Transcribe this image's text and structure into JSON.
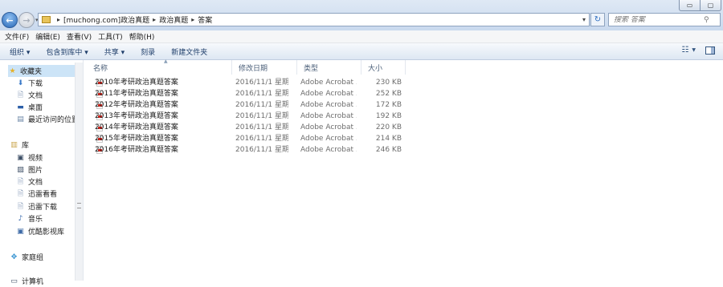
{
  "window": {
    "minimize_label": "▭",
    "close_label": "✕"
  },
  "address": {
    "crumbs": [
      "[muchong.com]政治真题",
      "政治真题",
      "答案"
    ],
    "separator": "▸"
  },
  "search": {
    "placeholder": "搜索 答案"
  },
  "menu": [
    "文件(F)",
    "编辑(E)",
    "查看(V)",
    "工具(T)",
    "帮助(H)"
  ],
  "commands": [
    "组织 ▾",
    "包含到库中 ▾",
    "共享 ▾",
    "刻录",
    "新建文件夹"
  ],
  "sidebar": {
    "favorites": "收藏夹",
    "favorite_items": [
      "下载",
      "文档",
      "桌面",
      "最近访问的位置"
    ],
    "library": "库",
    "library_items": [
      "视频",
      "图片",
      "文档",
      "迅雷看看",
      "迅雷下载",
      "音乐",
      "优酷影视库"
    ],
    "homegroup": "家庭组",
    "computer": "计算机"
  },
  "columns": {
    "name": "名称",
    "date": "修改日期",
    "type": "类型",
    "size": "大小"
  },
  "files": [
    {
      "name": "2010年考研政治真题答案",
      "date": "2016/11/1 星期...",
      "type": "Adobe Acrobat ...",
      "size": "230 KB"
    },
    {
      "name": "2011年考研政治真题答案",
      "date": "2016/11/1 星期...",
      "type": "Adobe Acrobat ...",
      "size": "252 KB"
    },
    {
      "name": "2012年考研政治真题答案",
      "date": "2016/11/1 星期...",
      "type": "Adobe Acrobat ...",
      "size": "172 KB"
    },
    {
      "name": "2013年考研政治真题答案",
      "date": "2016/11/1 星期...",
      "type": "Adobe Acrobat ...",
      "size": "192 KB"
    },
    {
      "name": "2014年考研政治真题答案",
      "date": "2016/11/1 星期...",
      "type": "Adobe Acrobat ...",
      "size": "220 KB"
    },
    {
      "name": "2015年考研政治真题答案",
      "date": "2016/11/1 星期...",
      "type": "Adobe Acrobat ...",
      "size": "214 KB"
    },
    {
      "name": "2016年考研政治真题答案",
      "date": "2016/11/1 星期...",
      "type": "Adobe Acrobat ...",
      "size": "246 KB"
    }
  ]
}
